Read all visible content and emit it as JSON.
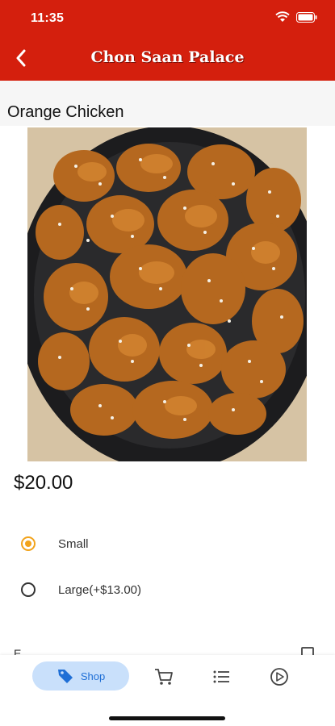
{
  "status_bar": {
    "time": "11:35"
  },
  "header": {
    "title": "Chon Saan Palace",
    "back_icon": "chevron-left-icon"
  },
  "item": {
    "name": "Orange Chicken",
    "price": "$20.00"
  },
  "options": [
    {
      "label": "Small",
      "selected": true
    },
    {
      "label": "Large(+$13.00)",
      "selected": false
    }
  ],
  "extras": {
    "label": "E..."
  },
  "tab_bar": {
    "shop_label": "Shop",
    "tabs": [
      "tag-icon",
      "cart-icon",
      "list-icon",
      "play-icon"
    ]
  },
  "colors": {
    "brand": "#d41f0d",
    "accent": "#f2a31b",
    "tab_active_bg": "#c9e0fb",
    "tab_active": "#1f6fd6"
  }
}
